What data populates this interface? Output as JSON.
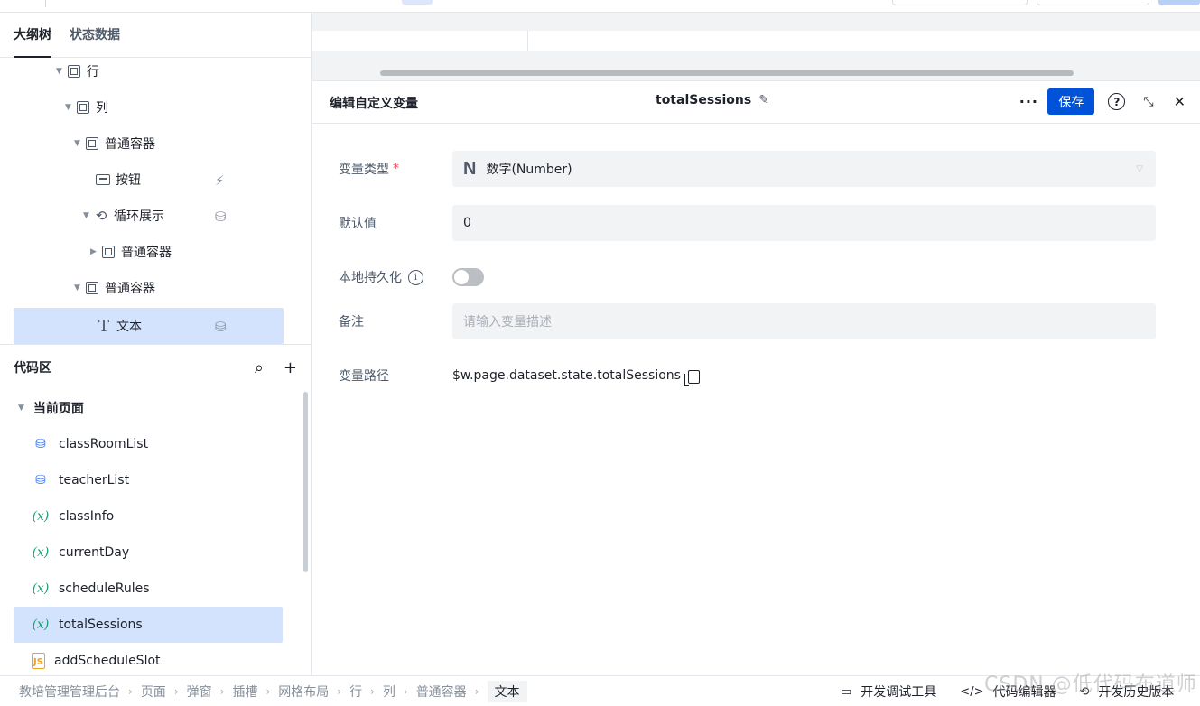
{
  "left_tabs": [
    "大纲树",
    "状态数据"
  ],
  "tree": [
    {
      "label": "行"
    },
    {
      "label": "列"
    },
    {
      "label": "普通容器"
    },
    {
      "label": "按钮"
    },
    {
      "label": "循环展示"
    },
    {
      "label": "普通容器"
    },
    {
      "label": "普通容器"
    },
    {
      "label": "文本"
    }
  ],
  "code": {
    "title": "代码区",
    "section": "当前页面",
    "items": [
      {
        "label": "classRoomList",
        "icon": "database-api-icon"
      },
      {
        "label": "teacherList",
        "icon": "database-api-icon"
      },
      {
        "label": "classInfo",
        "icon": "variable-icon"
      },
      {
        "label": "currentDay",
        "icon": "variable-icon"
      },
      {
        "label": "scheduleRules",
        "icon": "variable-icon"
      },
      {
        "label": "totalSessions",
        "icon": "variable-icon"
      },
      {
        "label": "addScheduleSlot",
        "icon": "js-file-icon"
      }
    ],
    "var_glyph": "(x)",
    "js_glyph": "JS"
  },
  "editor": {
    "title": "编辑自定义变量",
    "var_name": "totalSessions",
    "more": "···",
    "save": "保存",
    "help": "?",
    "fields": {
      "type_label": "变量类型",
      "required_mark": "*",
      "type_badge": "N",
      "type_value": "数字(Number)",
      "default_label": "默认值",
      "default_value": "0",
      "persist_label": "本地持久化",
      "persist_enabled": false,
      "note_label": "备注",
      "note_placeholder": "请输入变量描述",
      "path_label": "变量路径",
      "path_value": "$w.page.dataset.state.totalSessions"
    }
  },
  "breadcrumb": [
    "教培管理管理后台",
    "页面",
    "弹窗",
    "插槽",
    "网格布局",
    "行",
    "列",
    "普通容器",
    "文本"
  ],
  "bottom_tools": [
    "开发调试工具",
    "代码编辑器",
    "开发历史版本"
  ],
  "watermark": "CSDN @低代码布道师",
  "colors": {
    "accent": "#0052d9",
    "selected_bg": "#d3e3fd",
    "variable": "#1aa06b"
  }
}
